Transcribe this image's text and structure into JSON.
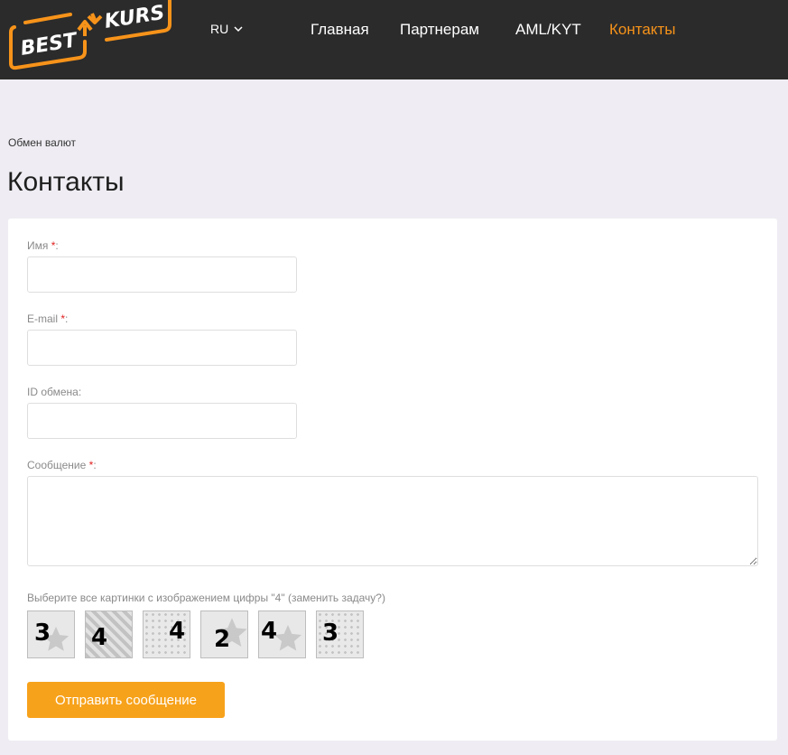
{
  "header": {
    "logo": {
      "word1": "BEST",
      "word2": "KURS"
    },
    "language": "RU",
    "nav": [
      {
        "label": "Главная"
      },
      {
        "label": "Партнерам"
      },
      {
        "label": "AML/KYT"
      },
      {
        "label": "Контакты",
        "active": true
      }
    ]
  },
  "breadcrumb": "Обмен валют",
  "page_title": "Контакты",
  "form": {
    "name_label": "Имя",
    "email_label": "E-mail",
    "exchange_id_label": "ID обмена:",
    "message_label": "Сообщение",
    "required_mark": "*",
    "field_suffix": ":",
    "captcha": {
      "instruction": "Выберите все картинки с изображением цифры \"4\"",
      "refresh_label": "(заменить задачу?)",
      "tiles": [
        "3",
        "4",
        "4",
        "2",
        "4",
        "3"
      ]
    },
    "submit_label": "Отправить сообщение"
  },
  "colors": {
    "header_bg": "#2b2b2b",
    "accent": "#f7931a",
    "button": "#f7a21b",
    "page_bg": "#efedf3",
    "required": "#e02020"
  }
}
